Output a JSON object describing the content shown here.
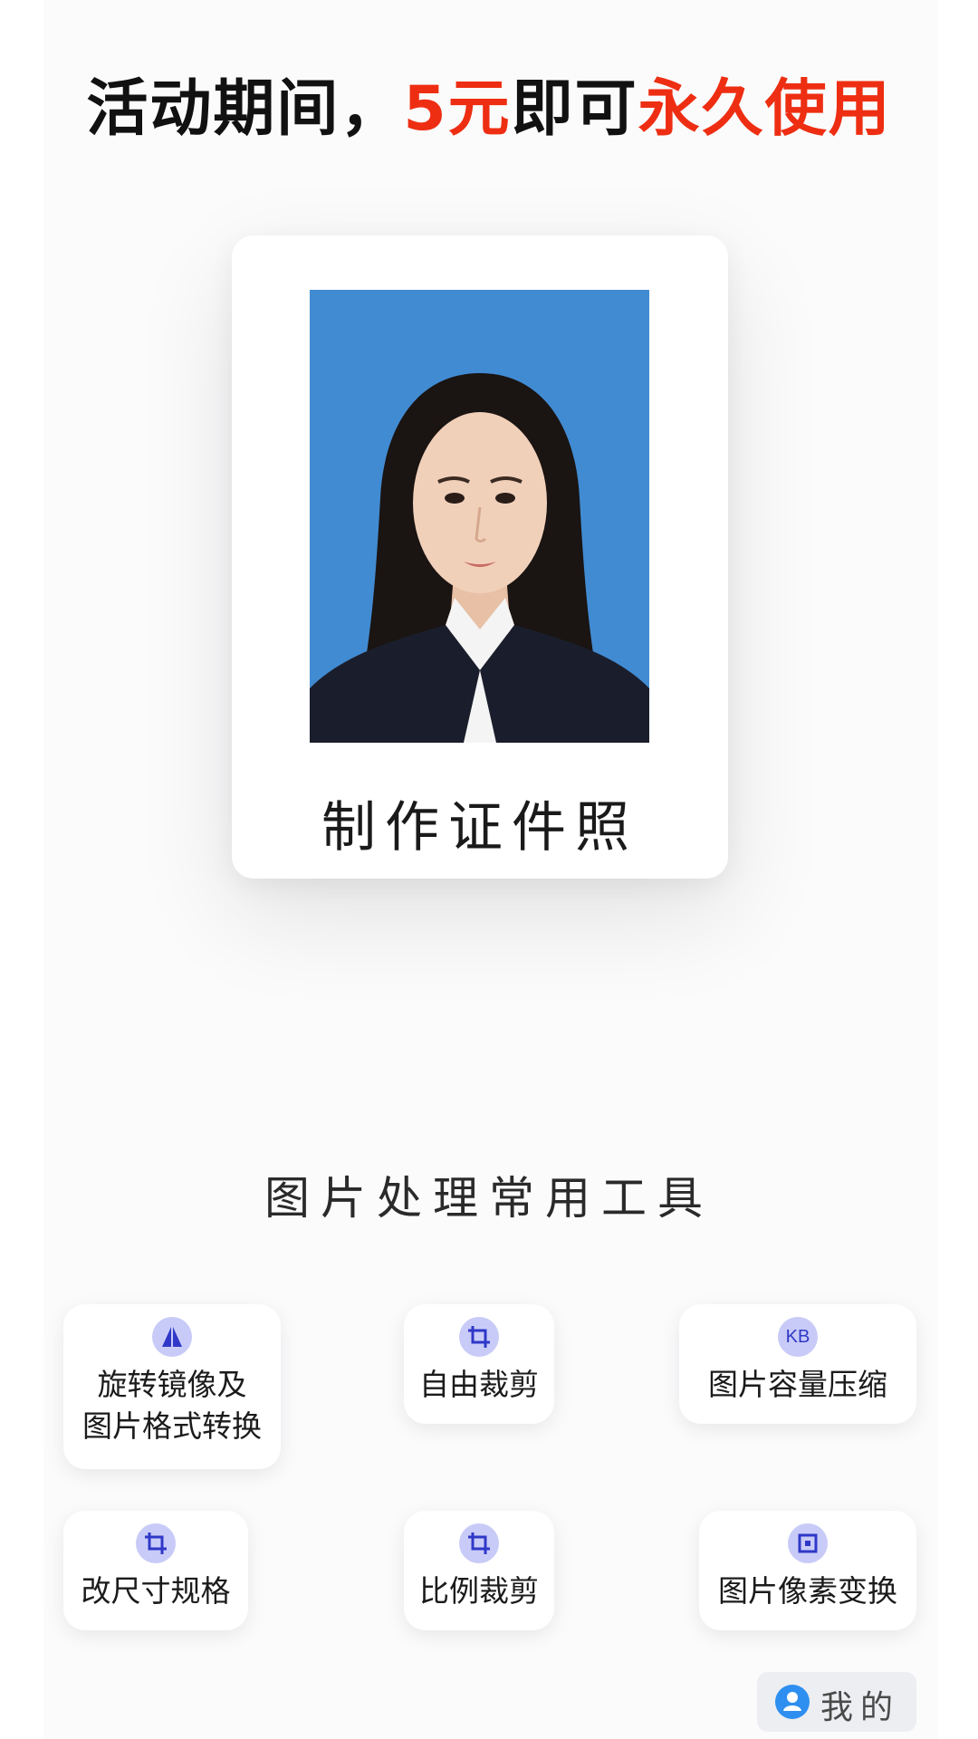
{
  "banner": {
    "part1": "活动期间，",
    "price": "5元",
    "part2": "即可",
    "part3": "永久使用"
  },
  "card": {
    "label": "制作证件照",
    "photo": "id-photo-portrait"
  },
  "tools": {
    "title": "图片处理常用工具",
    "items": [
      {
        "icon": "mirror-icon",
        "label_line1": "旋转镜像及",
        "label_line2": "图片格式转换"
      },
      {
        "icon": "crop-icon",
        "label": "自由裁剪"
      },
      {
        "icon": "kb-icon",
        "icon_text": "KB",
        "label": "图片容量压缩"
      },
      {
        "icon": "crop-icon",
        "label": "改尺寸规格"
      },
      {
        "icon": "crop-icon",
        "label": "比例裁剪"
      },
      {
        "icon": "pixel-icon",
        "label": "图片像素变换"
      }
    ]
  },
  "nav": {
    "mine_label": "我的",
    "mine_icon": "user-icon"
  },
  "colors": {
    "accent_red": "#ee2e12",
    "icon_bg": "#c8cbf7",
    "icon_fg": "#2f38c8",
    "photo_bg": "#418bd2",
    "user_icon": "#2e8ff0"
  }
}
